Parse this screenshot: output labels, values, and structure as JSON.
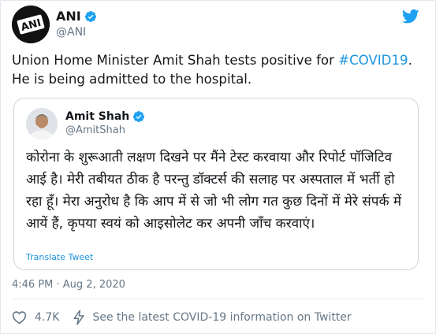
{
  "author": {
    "name": "ANI",
    "handle": "@ANI",
    "avatar_text": "ANI"
  },
  "tweet": {
    "text_before": "Union Home Minister Amit Shah tests positive for ",
    "hashtag": "#COVID19",
    "text_after": ".\nHe is being admitted to the hospital."
  },
  "quoted": {
    "name": "Amit Shah",
    "handle": "@AmitShah",
    "text": "कोरोना के शुरूआती लक्षण दिखने पर मैंने टेस्ट करवाया और रिपोर्ट पॉजिटिव आई है। मेरी तबीयत ठीक है परन्तु डॉक्टर्स की सलाह पर अस्पताल में भर्ती हो रहा हूँ। मेरा अनुरोध है कि आप में से जो भी लोग गत कुछ दिनों में मेरे संपर्क में आयें हैं, कृपया स्वयं को आइसोलेट कर अपनी जाँच करवाएं।",
    "translate_label": "Translate Tweet"
  },
  "timestamp": "4:46 PM · Aug 2, 2020",
  "actions": {
    "like_count": "4.7K",
    "covid_info": "See the latest COVID-19 information on Twitter"
  },
  "colors": {
    "link": "#1b95e0",
    "verified": "#1da1f2",
    "muted": "#657786"
  },
  "icons": [
    "verified-badge-icon",
    "twitter-bird-icon",
    "heart-icon",
    "lightning-icon"
  ]
}
